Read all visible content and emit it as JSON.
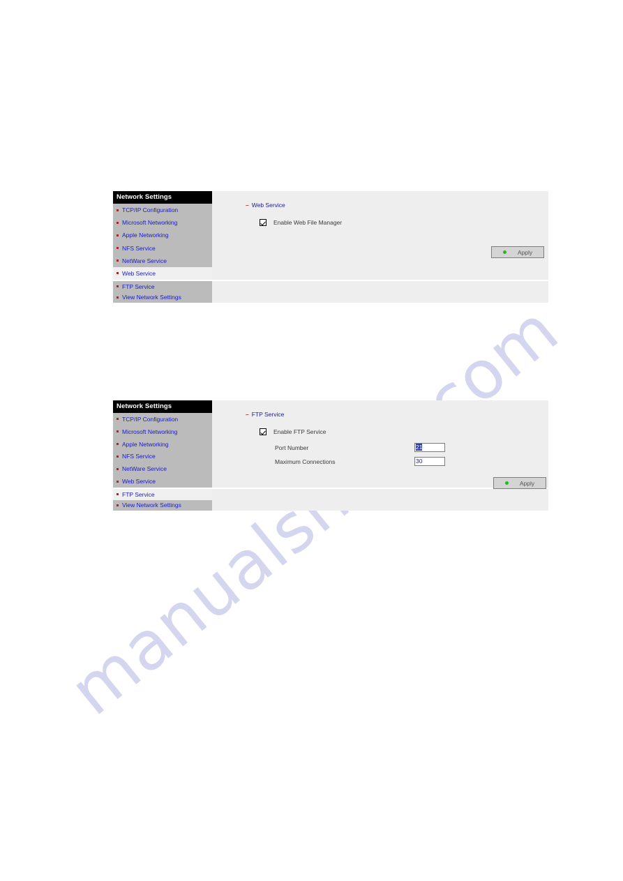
{
  "watermark": {
    "text": "manualshive.com"
  },
  "sidebar": {
    "title": "Network Settings",
    "items": [
      {
        "label": "TCP/IP Configuration"
      },
      {
        "label": "Microsoft Networking"
      },
      {
        "label": "Apple Networking"
      },
      {
        "label": "NFS Service"
      },
      {
        "label": "NetWare Service"
      },
      {
        "label": "Web Service"
      },
      {
        "label": "FTP Service"
      },
      {
        "label": "View Network Settings"
      }
    ]
  },
  "panels": [
    {
      "name": "web-service-panel",
      "selected_item": "Web Service",
      "section": {
        "dash": "–",
        "title": "Web Service"
      },
      "checkbox": {
        "label": "Enable Web File Manager",
        "checked": true
      },
      "apply": {
        "label": "Apply",
        "dot_color": "#22bb22"
      }
    },
    {
      "name": "ftp-service-panel",
      "selected_item": "FTP Service",
      "section": {
        "dash": "–",
        "title": "FTP Service"
      },
      "checkbox": {
        "label": "Enable FTP Service",
        "checked": true
      },
      "fields": [
        {
          "label": "Port Number",
          "value": "21",
          "selected": true
        },
        {
          "label": "Maximum Connections",
          "value": "30",
          "selected": false
        }
      ],
      "apply": {
        "label": "Apply",
        "dot_color": "#22bb22"
      }
    }
  ],
  "colors": {
    "sidebar_bg": "#bbbbbb",
    "sidebar_header_bg": "#000000",
    "link_blue": "#1919cc",
    "bullet_red": "#dd1111",
    "content_bg": "#eeeeee",
    "selected_row_bg": "#f0f0f0",
    "accent_green": "#22bb22",
    "watermark": "#b9bde4"
  }
}
